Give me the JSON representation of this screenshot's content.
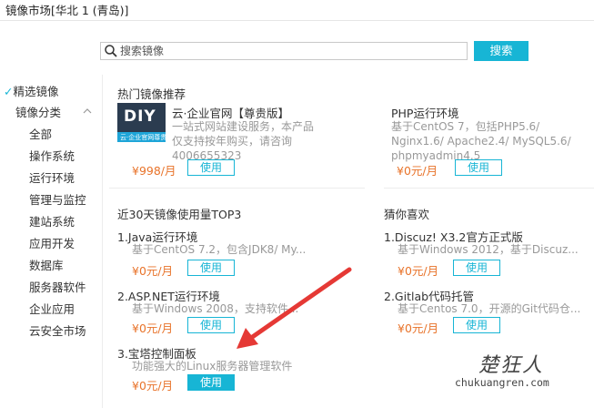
{
  "window": {
    "title": "镜像市场[华北 1 (青岛)]"
  },
  "search": {
    "placeholder": "搜索镜像",
    "button_label": "搜索"
  },
  "sidebar": {
    "featured": "精选镜像",
    "category_header": "镜像分类",
    "items": [
      "全部",
      "操作系统",
      "运行环境",
      "管理与监控",
      "建站系统",
      "应用开发",
      "数据库",
      "服务器软件",
      "企业应用",
      "云安全市场"
    ]
  },
  "hot": {
    "title": "热门镜像推荐",
    "items": [
      {
        "logo_text": "DIY",
        "logo_sub": "云·企业官网尊贵版",
        "title": "云·企业官网【尊贵版】",
        "desc": [
          "一站式网站建设服务，本产品",
          "仅支持按年购买，请咨询",
          "4006655323"
        ],
        "price": "¥998/月",
        "button": "使用"
      },
      {
        "title": "PHP运行环境",
        "desc": [
          "基于CentOS 7，包括PHP5.6/",
          "Nginx1.6/ Apache2.4/ MySQL5.6/",
          "phpmyadmin4.5"
        ],
        "price": "¥0元/月",
        "button": "使用"
      }
    ]
  },
  "top3": {
    "title": "近30天镜像使用量TOP3",
    "items": [
      {
        "title": "1.Java运行环境",
        "desc": "基于CentOS 7.2，包含JDK8/ My...",
        "price": "¥0元/月",
        "button": "使用"
      },
      {
        "title": "2.ASP.NET运行环境",
        "desc": "基于Windows 2008，支持软件...",
        "price": "¥0元/月",
        "button": "使用"
      },
      {
        "title": "3.宝塔控制面板",
        "desc": "功能强大的Linux服务器管理软件",
        "price": "¥0元/月",
        "button": "使用"
      }
    ]
  },
  "guess": {
    "title": "猜你喜欢",
    "items": [
      {
        "title": "1.Discuz! X3.2官方正式版",
        "desc": "基于Windows 2012，基于Discuz...",
        "price": "¥0元/月",
        "button": "使用"
      },
      {
        "title": "2.Gitlab代码托管",
        "desc": "基于Centos 7.0，开源的Git代码仓...",
        "price": "¥0元/月",
        "button": "使用"
      }
    ]
  },
  "watermark": {
    "brand": "楚狂人",
    "url": "chukuangren.com"
  },
  "colors": {
    "accent": "#17b5d5",
    "price": "#e8732a",
    "arrow": "#e53935"
  }
}
